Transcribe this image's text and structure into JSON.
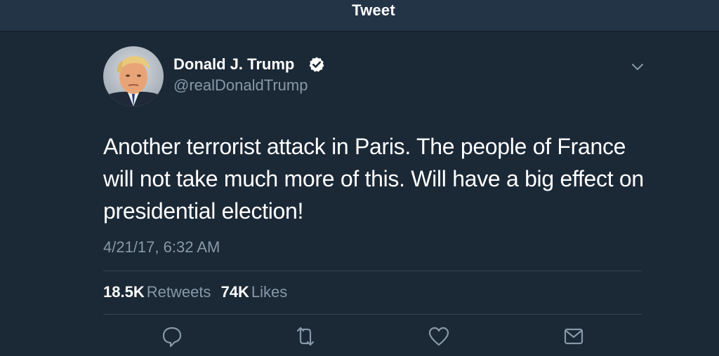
{
  "header": {
    "title": "Tweet"
  },
  "author": {
    "name": "Donald J. Trump",
    "handle": "@realDonaldTrump",
    "verified": true,
    "avatar_icon": "profile-photo"
  },
  "tweet": {
    "text": "Another terrorist attack in Paris. The people of France will not take much more of this. Will have a big effect on presidential election!",
    "timestamp": "4/21/17, 6:32 AM"
  },
  "stats": {
    "retweets_count": "18.5K",
    "retweets_label": "Retweets",
    "likes_count": "74K",
    "likes_label": "Likes"
  },
  "actions": [
    "reply-icon",
    "retweet-icon",
    "like-icon",
    "direct-message-icon"
  ],
  "colors": {
    "background": "#1b2836",
    "header_background": "#243447",
    "secondary_text": "#8899a6",
    "divider": "#38444d",
    "icon": "#8899a6"
  }
}
